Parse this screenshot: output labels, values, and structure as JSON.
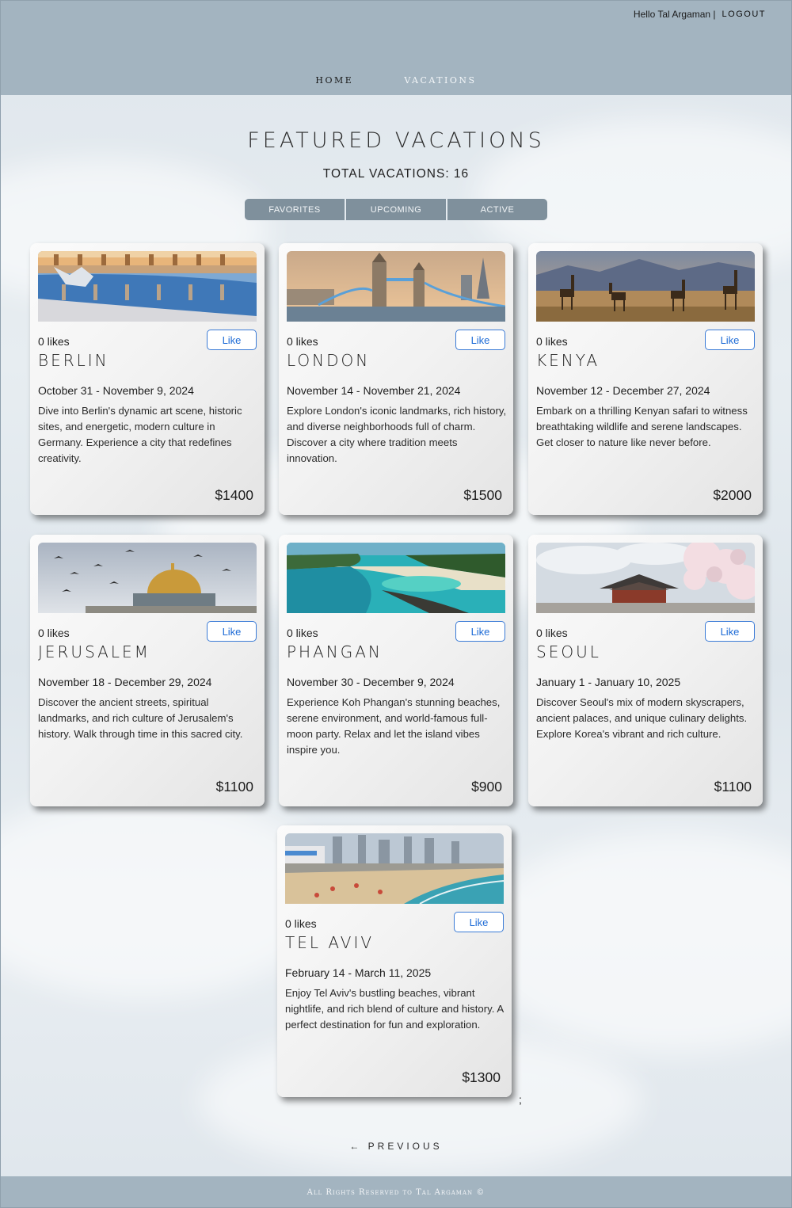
{
  "header": {
    "greeting": "Hello Tal Argaman |",
    "logout_label": "LOGOUT",
    "nav": {
      "home": "HOME",
      "vacations": "VACATIONS"
    }
  },
  "main": {
    "title": "FEATURED VACATIONS",
    "total": "TOTAL VACATIONS: 16",
    "filters": {
      "favorites": "FAVORITES",
      "upcoming": "UPCOMING",
      "active": "ACTIVE"
    },
    "cards": [
      {
        "likes": "0 likes",
        "like_label": "Like",
        "destination": "BERLIN",
        "dates": "October 31 - November 9, 2024",
        "description": "Dive into Berlin's dynamic art scene, historic sites, and energetic, modern culture in Germany. Experience a city that redefines creativity.",
        "price": "$1400",
        "image": "berlin-fountain"
      },
      {
        "likes": "0 likes",
        "like_label": "Like",
        "destination": "LONDON",
        "dates": "November 14 - November 21, 2024",
        "description": "Explore London's iconic landmarks, rich history, and diverse neighborhoods full of charm. Discover a city where tradition meets innovation.",
        "price": "$1500",
        "image": "tower-bridge"
      },
      {
        "likes": "0 likes",
        "like_label": "Like",
        "destination": "KENYA",
        "dates": "November 12 - December 27, 2024",
        "description": "Embark on a thrilling Kenyan safari to witness breathtaking wildlife and serene landscapes. Get closer to nature like never before.",
        "price": "$2000",
        "image": "giraffes-savanna"
      },
      {
        "likes": "0 likes",
        "like_label": "Like",
        "destination": "JERUSALEM",
        "dates": "November 18 - December 29, 2024",
        "description": "Discover the ancient streets, spiritual landmarks, and rich culture of Jerusalem's history. Walk through time in this sacred city.",
        "price": "$1100",
        "image": "dome-of-the-rock"
      },
      {
        "likes": "0 likes",
        "like_label": "Like",
        "destination": "PHANGAN",
        "dates": "November 30 - December 9, 2024",
        "description": "Experience Koh Phangan's stunning beaches, serene environment, and world-famous full-moon party. Relax and let the island vibes inspire you.",
        "price": "$900",
        "image": "tropical-lagoon"
      },
      {
        "likes": "0 likes",
        "like_label": "Like",
        "destination": "SEOUL",
        "dates": "January 1 - January 10, 2025",
        "description": "Discover Seoul's mix of modern skyscrapers, ancient palaces, and unique culinary delights. Explore Korea's vibrant and rich culture.",
        "price": "$1100",
        "image": "palace-cherry-blossom"
      },
      {
        "likes": "0 likes",
        "like_label": "Like",
        "destination": "TEL AVIV",
        "dates": "February 14 - March 11, 2025",
        "description": "Enjoy Tel Aviv's bustling beaches, vibrant nightlife, and rich blend of culture and history. A perfect destination for fun and exploration.",
        "price": "$1300",
        "image": "city-beach"
      }
    ],
    "stray_text": ";",
    "previous_label": "← PREVIOUS"
  },
  "footer": {
    "text": "All Rights Reserved to Tal Argaman ©"
  },
  "colors": {
    "header_bg": "#a3b4c0",
    "filter_bg": "#7f909c",
    "like_border": "#3b7bd6"
  }
}
